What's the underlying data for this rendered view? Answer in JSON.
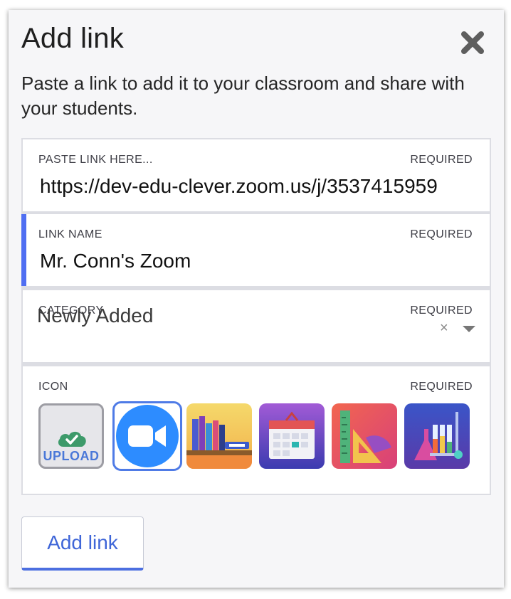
{
  "dialog": {
    "title": "Add link",
    "description": "Paste a link to add it to your classroom and share with your students."
  },
  "fields": {
    "link": {
      "label": "PASTE LINK HERE...",
      "required": "REQUIRED",
      "value": "https://dev-edu-clever.zoom.us/j/3537415959"
    },
    "name": {
      "label": "LINK NAME",
      "required": "REQUIRED",
      "value": "Mr. Conn's Zoom"
    },
    "category": {
      "label": "CATEGORY",
      "required": "REQUIRED",
      "value": "Newly Added",
      "clear": "×"
    },
    "icon": {
      "label": "ICON",
      "required": "REQUIRED",
      "upload_label": "UPLOAD",
      "options": [
        "zoom-icon",
        "library-books-icon",
        "calendar-icon",
        "ruler-protractor-icon",
        "lab-flasks-icon"
      ],
      "selected": "zoom-icon"
    }
  },
  "submit": {
    "label": "Add link"
  },
  "colors": {
    "accent": "#4f6ef2",
    "button_text": "#3f66d8",
    "zoom_blue": "#2d8cff"
  }
}
